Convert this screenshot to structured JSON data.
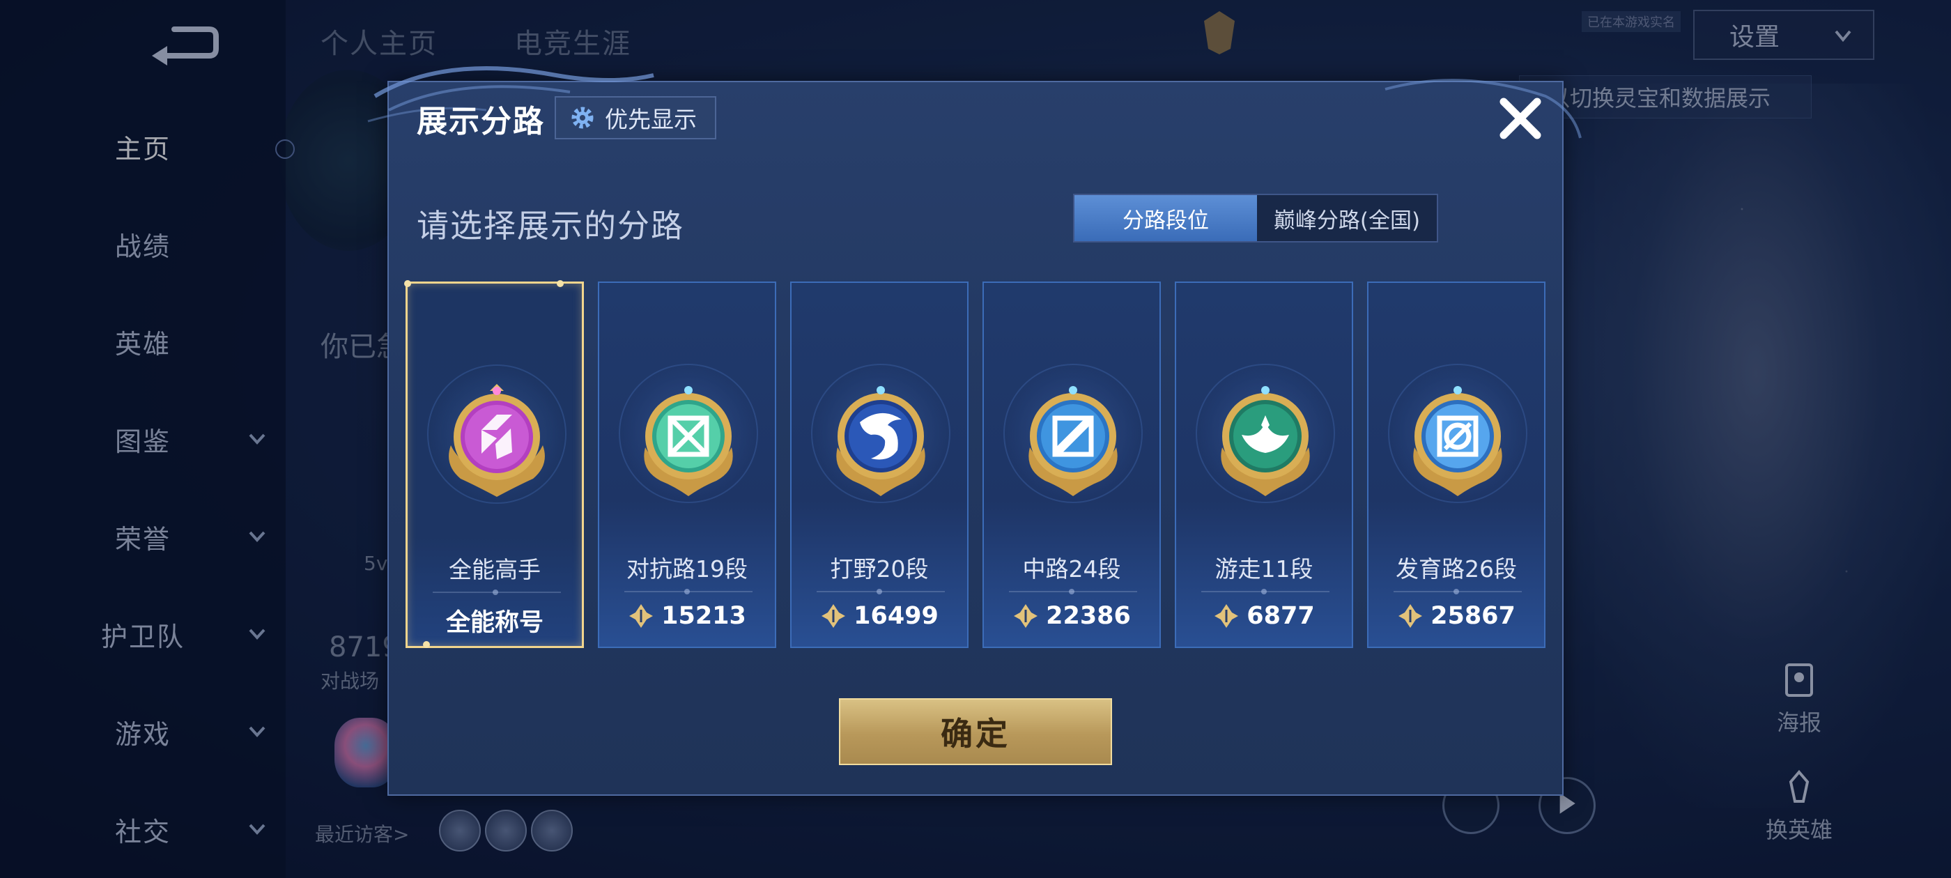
{
  "background": {
    "top_tabs": [
      "个人主页",
      "电竞生涯"
    ],
    "settings_label": "设置",
    "settings_badge": "已在本游戏实名",
    "hint_text": "以切换灵宝和数据展示",
    "profile_snippet": {
      "greeting": "你已急",
      "level_text": "5v",
      "stat_number": "8719",
      "stat_caption": "对战场",
      "recent_visitors_label": "最近访客>"
    },
    "right_actions": [
      {
        "label": "海报",
        "icon": "poster-icon"
      },
      {
        "label": "换英雄",
        "icon": "swap-hero-icon"
      }
    ]
  },
  "sidebar": {
    "items": [
      {
        "label": "主页",
        "active": true,
        "has_chevron": false
      },
      {
        "label": "战绩",
        "active": false,
        "has_chevron": false
      },
      {
        "label": "英雄",
        "active": false,
        "has_chevron": false
      },
      {
        "label": "图鉴",
        "active": false,
        "has_chevron": true
      },
      {
        "label": "荣誉",
        "active": false,
        "has_chevron": true
      },
      {
        "label": "护卫队",
        "active": false,
        "has_chevron": true
      },
      {
        "label": "游戏",
        "active": false,
        "has_chevron": true
      },
      {
        "label": "社交",
        "active": false,
        "has_chevron": true
      }
    ]
  },
  "modal": {
    "title": "展示分路",
    "priority_button": "优先显示",
    "subtitle": "请选择展示的分路",
    "segment": {
      "options": [
        "分路段位",
        "巅峰分路(全国)"
      ],
      "selected_index": 0
    },
    "cards": [
      {
        "name": "全能高手",
        "value": "全能称号",
        "emblem": "all-round-purple",
        "selected": true
      },
      {
        "name": "对抗路19段",
        "value": "15213",
        "emblem": "clash-lane-teal",
        "selected": false
      },
      {
        "name": "打野20段",
        "value": "16499",
        "emblem": "jungle-dragon-blue",
        "selected": false
      },
      {
        "name": "中路24段",
        "value": "22386",
        "emblem": "mid-lane-blue",
        "selected": false
      },
      {
        "name": "游走11段",
        "value": "6877",
        "emblem": "roam-wings-green",
        "selected": false
      },
      {
        "name": "发育路26段",
        "value": "25867",
        "emblem": "farm-lane-blue",
        "selected": false
      }
    ],
    "confirm_button": "确定"
  },
  "colors": {
    "accent_gold": "#f2d58d",
    "panel_blue": "#223760",
    "selected_tab": "#4a7cc8"
  }
}
